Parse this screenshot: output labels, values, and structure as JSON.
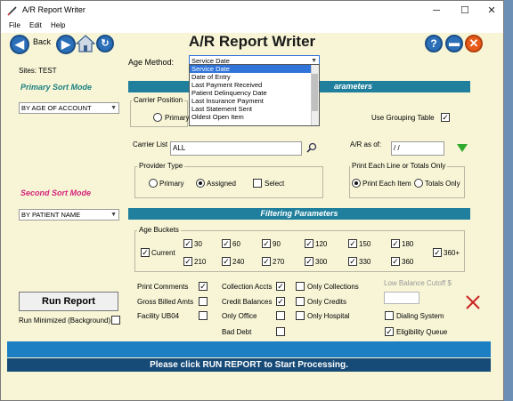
{
  "window": {
    "title": "A/R Report Writer",
    "controls": {
      "minimize": "─",
      "maximize": "☐",
      "close": "✕"
    }
  },
  "menu": {
    "file": "File",
    "edit": "Edit",
    "help": "Help"
  },
  "toolbar": {
    "back": "Back",
    "page_title": "A/R Report Writer"
  },
  "sites": "Sites: TEST",
  "primary_sort": {
    "label": "Primary Sort Mode",
    "value": "BY AGE OF ACCOUNT"
  },
  "second_sort": {
    "label": "Second Sort Mode",
    "value": "BY PATIENT NAME"
  },
  "age_method": {
    "label": "Age Method:",
    "value": "Service Date",
    "options": [
      "Service Date",
      "Date of Entry",
      "Last Payment Received",
      "Patient Delinquency Date",
      "Last Insurance Payment",
      "Last Statement Sent",
      "Oldest Open Item"
    ]
  },
  "params_band": "arameters",
  "carrier_position": {
    "label": "Carrier Position",
    "primary": "Primary"
  },
  "use_grouping": "Use Grouping Table",
  "carrier_list": {
    "label": "Carrier List",
    "value": "ALL"
  },
  "ar_as_of": {
    "label": "A/R as of:",
    "value": " /  /"
  },
  "provider_type": {
    "label": "Provider Type",
    "primary": "Primary",
    "assigned": "Assigned",
    "select": "Select"
  },
  "print_each": {
    "label": "Print Each Line or Totals Only",
    "each_item": "Print Each Item",
    "totals_only": "Totals Only"
  },
  "filtering_band": "Filtering  Parameters",
  "age_buckets": {
    "label": "Age Buckets",
    "current": "Current",
    "row1": [
      "30",
      "60",
      "90",
      "120",
      "150",
      "180"
    ],
    "row2": [
      "210",
      "240",
      "270",
      "300",
      "330",
      "360"
    ],
    "extra": "360+"
  },
  "options_col1": [
    "Print Comments",
    "Gross Billed Amts",
    "Facility UB04"
  ],
  "options_col2": [
    "Collection Accts",
    "Credit Balances",
    "Only Office",
    "Bad Debt"
  ],
  "options_col3": [
    "Only Collections",
    "Only Credits",
    "Only Hospital"
  ],
  "low_balance": "Low Balance Cutoff $",
  "dialing_system": "Dialing System",
  "eligibility_queue": "Eligibility Queue",
  "run_report": "Run Report",
  "run_minimized": "Run Minimized (Background)",
  "status_message": "Please click RUN REPORT to Start Processing."
}
